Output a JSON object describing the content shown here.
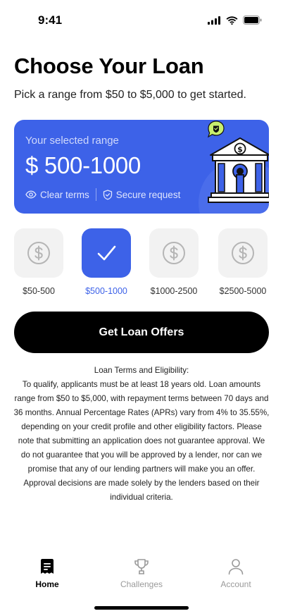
{
  "status_bar": {
    "time": "9:41"
  },
  "header": {
    "title": "Choose Your Loan",
    "subtitle": "Pick a range from $50 to $5,000 to get started."
  },
  "range_card": {
    "label": "Your selected range",
    "value": "$ 500-1000",
    "features": [
      "Clear terms",
      "Secure request"
    ],
    "colors": {
      "background": "#3d62e8",
      "accent": "#c8ef6e"
    }
  },
  "amount_options": [
    {
      "label": "$50-500",
      "selected": false,
      "icon": "dollar-icon"
    },
    {
      "label": "$500-1000",
      "selected": true,
      "icon": "checkmark-icon"
    },
    {
      "label": "$1000-2500",
      "selected": false,
      "icon": "dollar-icon"
    },
    {
      "label": "$2500-5000",
      "selected": false,
      "icon": "dollar-icon"
    }
  ],
  "cta": {
    "label": "Get Loan Offers"
  },
  "terms": {
    "heading": "Loan Terms and Eligibility:",
    "body": "To qualify, applicants must be at least 18 years old. Loan amounts range from $50 to $5,000, with repayment terms between 70 days and 36 months. Annual Percentage Rates (APRs) vary from 4% to 35.55%, depending on your credit profile and other eligibility factors. Please note that submitting an application does not guarantee approval. We do not guarantee that you will be approved by a lender, nor can we promise that any of our lending partners will make you an offer. Approval decisions are made solely by the lenders based on their individual criteria."
  },
  "tabbar": {
    "items": [
      {
        "label": "Home",
        "icon": "receipt-icon",
        "active": true
      },
      {
        "label": "Challenges",
        "icon": "trophy-icon",
        "active": false
      },
      {
        "label": "Account",
        "icon": "user-icon",
        "active": false
      }
    ]
  }
}
